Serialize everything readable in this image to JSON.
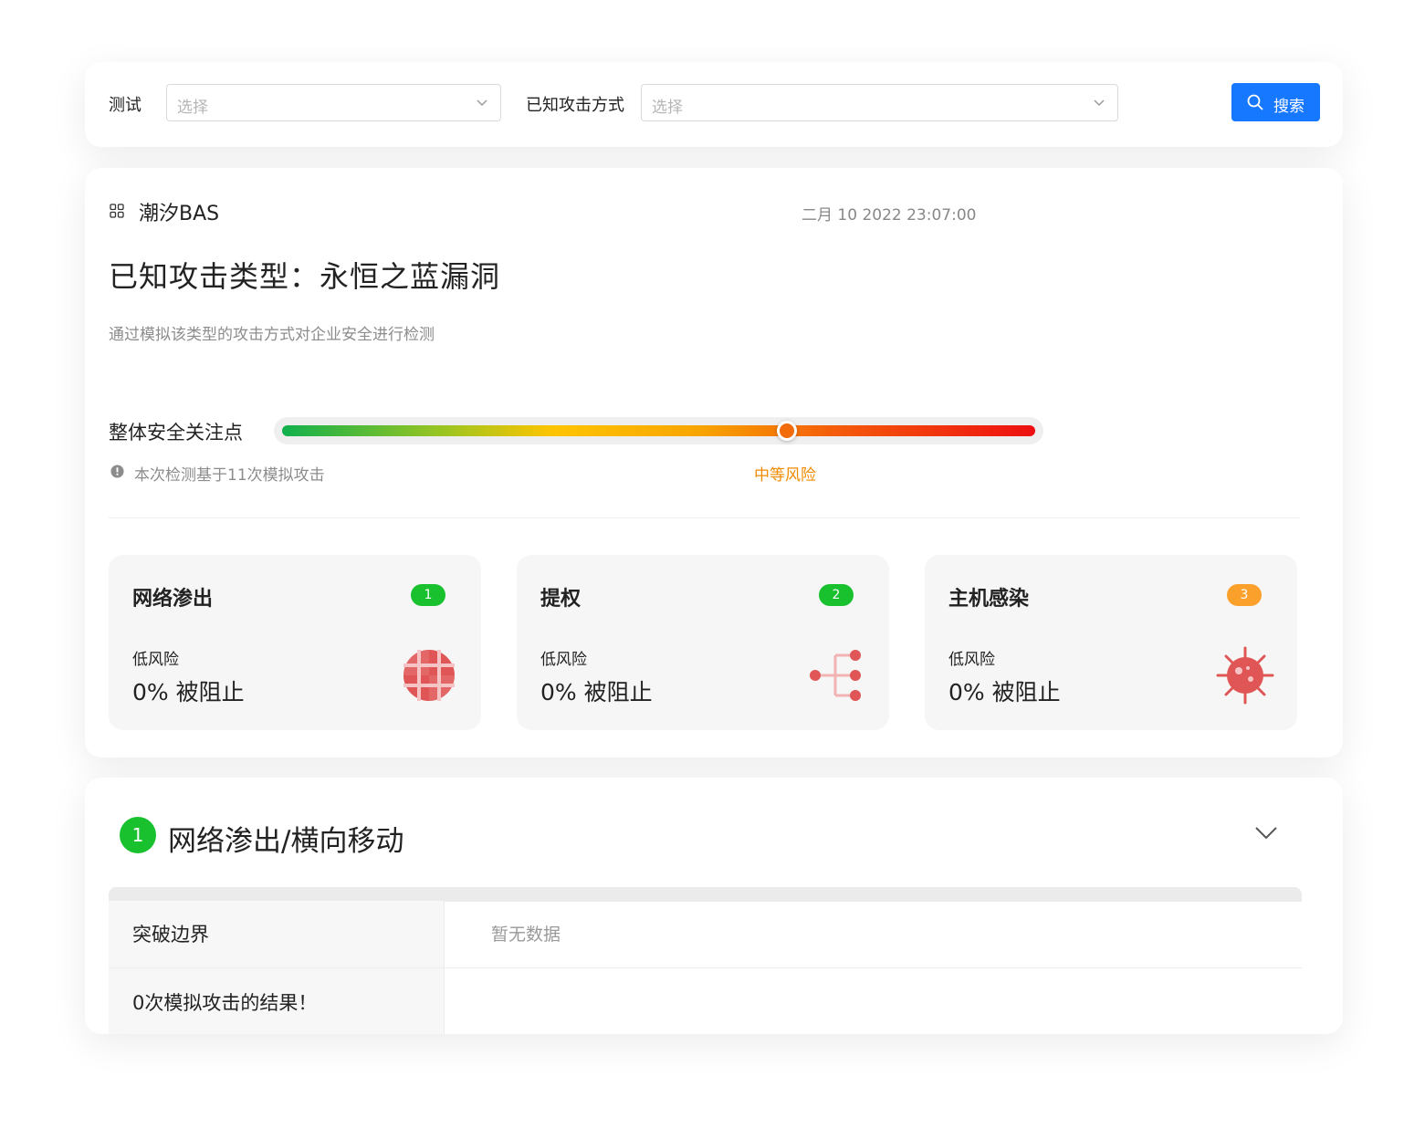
{
  "filters": {
    "test_label": "测试",
    "test_placeholder": "选择",
    "attack_label": "已知攻击方式",
    "attack_placeholder": "选择",
    "search_label": "搜索"
  },
  "report": {
    "brand": "潮汐BAS",
    "datetime": "二月 10  2022 23:07:00",
    "title": "已知攻击类型：永恒之蓝漏洞",
    "description": "通过模拟该类型的攻击方式对企业安全进行检测",
    "risk_label": "整体安全关注点",
    "risk_level_text": "中等风险",
    "risk_position": 0.67,
    "note": "本次检测基于11次模拟攻击"
  },
  "stats": [
    {
      "name": "网络渗出",
      "count": "1",
      "badge_color": "#19c12e",
      "risk": "低风险",
      "blocked": "0% 被阻止",
      "icon": "globe-icon"
    },
    {
      "name": "提权",
      "count": "2",
      "badge_color": "#19c12e",
      "risk": "低风险",
      "blocked": "0% 被阻止",
      "icon": "branch-icon"
    },
    {
      "name": "主机感染",
      "count": "3",
      "badge_color": "#fba12b",
      "risk": "低风险",
      "blocked": "0% 被阻止",
      "icon": "virus-icon"
    }
  ],
  "section": {
    "number": "1",
    "title": "网络渗出/横向移动",
    "rows": [
      {
        "label": "突破边界",
        "value": "暂无数据"
      },
      {
        "label": "0次模拟攻击的结果！",
        "value": ""
      }
    ]
  },
  "colors": {
    "accent": "#1677ff",
    "green": "#19c12e",
    "orange": "#f08b00",
    "icon_red": "#e05555"
  }
}
